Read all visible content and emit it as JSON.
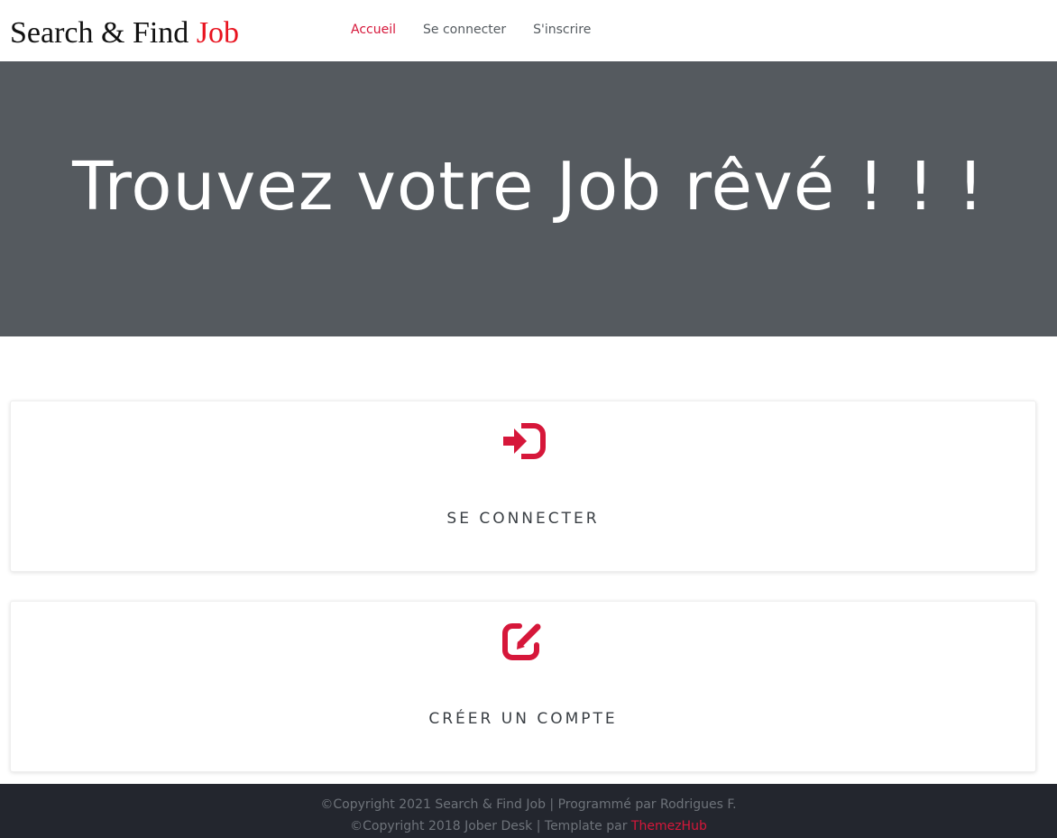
{
  "header": {
    "brand": {
      "text": "Search & Find ",
      "accent": "Job"
    },
    "nav": [
      {
        "label": "Accueil",
        "active": true
      },
      {
        "label": "Se connecter",
        "active": false
      },
      {
        "label": "S'inscrire",
        "active": false
      }
    ]
  },
  "hero": {
    "title": "Trouvez votre Job rêvé ! ! !"
  },
  "cards": [
    {
      "icon": "sign-in-icon",
      "label": "SE CONNECTER"
    },
    {
      "icon": "edit-icon",
      "label": "CRÉER UN COMPTE"
    }
  ],
  "footer": {
    "line1": "©Copyright 2021 Search & Find Job | Programmé par Rodrigues F.",
    "line2_prefix": "©Copyright 2018 Jober Desk | Template par ",
    "line2_link": "ThemezHub"
  },
  "colors": {
    "accent": "#d6173a",
    "brand_accent": "#e8131f",
    "hero_bg": "#555a5f",
    "footer_bg": "#23262e"
  }
}
